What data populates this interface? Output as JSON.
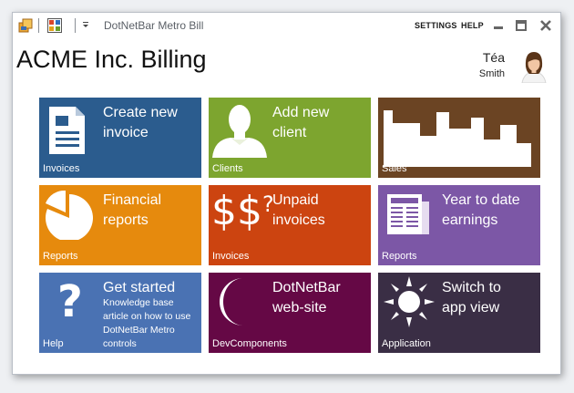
{
  "window": {
    "title": "DotNetBar Metro Bill",
    "settings_label": "SETTINGS",
    "help_label": "HELP"
  },
  "app": {
    "title": "ACME Inc. Billing"
  },
  "user": {
    "first_name": "Téa",
    "last_name": "Smith"
  },
  "tiles": [
    {
      "title": "Create new\ninvoice",
      "label": "Invoices",
      "color": "#2b5c8e",
      "icon": "document-icon"
    },
    {
      "title": "Add new\nclient",
      "label": "Clients",
      "color": "#7da52f",
      "icon": "person-icon"
    },
    {
      "title": "",
      "label": "Sales",
      "color": "#6b4423",
      "icon": "sales-chart-icon"
    },
    {
      "title": "Financial\nreports",
      "label": "Reports",
      "color": "#e68a0d",
      "icon": "pie-chart-icon"
    },
    {
      "title": "Unpaid\ninvoices",
      "label": "Invoices",
      "color": "#cc4410",
      "icon": "dollar-icon"
    },
    {
      "title": "Year to date\nearnings",
      "label": "Reports",
      "color": "#7c57a6",
      "icon": "newspaper-icon"
    },
    {
      "title": "Get started",
      "description": "Knowledge base article on how to use DotNetBar Metro controls",
      "label": "Help",
      "color": "#4a72b3",
      "icon": "question-mark-icon"
    },
    {
      "title": "DotNetBar\nweb-site",
      "label": "DevComponents",
      "color": "#650845",
      "icon": "crescent-icon"
    },
    {
      "title": "Switch to\napp view",
      "label": "Application",
      "color": "#3a2e45",
      "icon": "sun-icon"
    }
  ]
}
